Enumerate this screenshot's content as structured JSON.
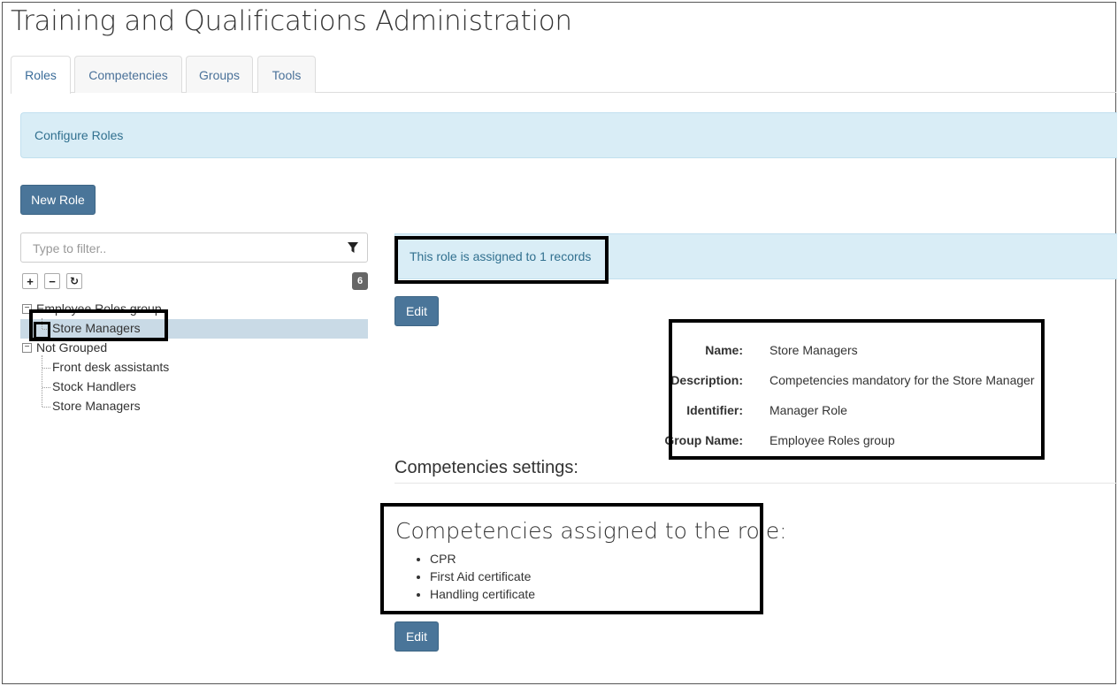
{
  "page": {
    "title": "Training and Qualifications Administration"
  },
  "tabs": [
    {
      "label": "Roles",
      "active": true
    },
    {
      "label": "Competencies",
      "active": false
    },
    {
      "label": "Groups",
      "active": false
    },
    {
      "label": "Tools",
      "active": false
    }
  ],
  "info": {
    "text": "Configure Roles"
  },
  "toolbar": {
    "new_role_label": "New Role"
  },
  "filter": {
    "placeholder": "Type to filter..",
    "value": ""
  },
  "tree": {
    "count": "6",
    "expand_glyph": "+",
    "collapse_glyph": "−",
    "refresh_glyph": "↻",
    "groups": [
      {
        "label": "Employee Roles group",
        "children": [
          "Store Managers"
        ]
      },
      {
        "label": "Not Grouped",
        "children": [
          "Front desk assistants",
          "Stock Handlers",
          "Store Managers"
        ]
      }
    ]
  },
  "details": {
    "assigned_text": "This role is assigned to 1 records",
    "edit_label": "Edit",
    "name_label": "Name:",
    "name_value": "Store Managers",
    "description_label": "Description:",
    "description_value": "Competencies mandatory for the Store Manager",
    "identifier_label": "Identifier:",
    "identifier_value": "Manager Role",
    "group_label": "Group Name:",
    "group_value": "Employee Roles group"
  },
  "competencies": {
    "section_title": "Competencies settings:",
    "assigned_title": "Competencies assigned to the role:",
    "items": [
      "CPR",
      "First Aid certificate",
      "Handling certificate"
    ],
    "edit_label": "Edit"
  },
  "colors": {
    "accent": "#4a7599",
    "info_bg": "#d9edf6",
    "info_text": "#31708f",
    "selected_row": "#c9dae6"
  }
}
